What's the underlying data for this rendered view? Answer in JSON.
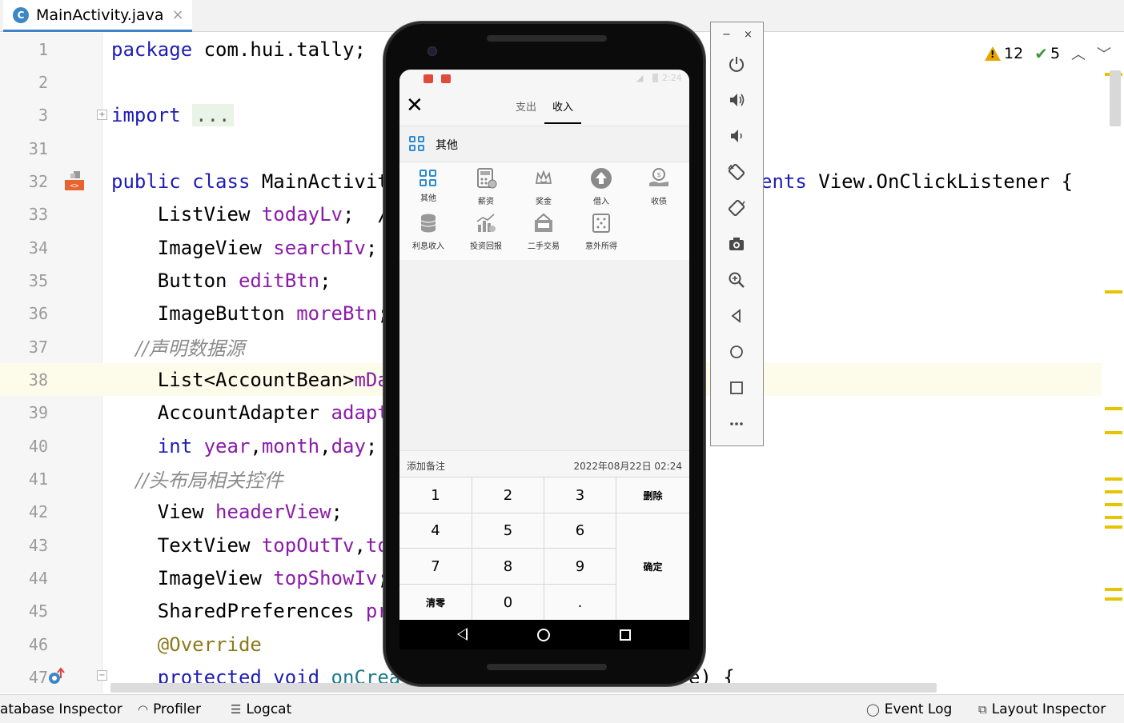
{
  "tab": {
    "icon": "C",
    "title": "MainActivity.java"
  },
  "inspections": {
    "warnings": "12",
    "ok": "5"
  },
  "editor": {
    "lines": [
      {
        "n": "1",
        "t": "package com.hui.tally;"
      },
      {
        "n": "2",
        "t": ""
      },
      {
        "n": "3",
        "kw": "import",
        "fold": "..."
      },
      {
        "n": "31",
        "t": ""
      },
      {
        "n": "32",
        "kw": "public class",
        "t": " MainActivity",
        "kw2": "ents",
        "t2": " View.OnClickListener {"
      },
      {
        "n": "33",
        "t": "    ListView ",
        "f": "todayLv",
        "t2": ";  /"
      },
      {
        "n": "34",
        "t": "    ImageView ",
        "f": "searchIv",
        "t2": ";"
      },
      {
        "n": "35",
        "t": "    Button ",
        "f": "editBtn",
        "t2": ";"
      },
      {
        "n": "36",
        "t": "    ImageButton ",
        "f": "moreBtn",
        "t2": ";"
      },
      {
        "n": "37",
        "c": "    //声明数据源"
      },
      {
        "n": "38",
        "t": "    List<AccountBean>",
        "f": "mDa"
      },
      {
        "n": "39",
        "t": "    AccountAdapter ",
        "f": "adapt"
      },
      {
        "n": "40",
        "kw": "    int",
        "f": " year",
        "t": ",",
        "f2": "month",
        "t2": ",",
        "f3": "day",
        "t3": ";"
      },
      {
        "n": "41",
        "c": "    //头布局相关控件"
      },
      {
        "n": "42",
        "t": "    View ",
        "f": "headerView",
        "t2": ";"
      },
      {
        "n": "43",
        "t": "    TextView ",
        "f": "topOutTv",
        "t2": ",",
        "f2": "to"
      },
      {
        "n": "44",
        "t": "    ImageView ",
        "f": "topShowIv",
        "t2": ";"
      },
      {
        "n": "45",
        "t": "    SharedPreferences ",
        "f": "pr"
      },
      {
        "n": "46",
        "a": "    @Override"
      },
      {
        "n": "47",
        "kw": "    protected void",
        "m": " onCrea",
        "t": "e) {"
      }
    ]
  },
  "bottom_tools": {
    "database": "atabase Inspector",
    "profiler": "Profiler",
    "logcat": "Logcat",
    "event_log": "Event Log",
    "layout_inspector": "Layout Inspector"
  },
  "phone": {
    "status_time": "2:24",
    "tabs": {
      "expense": "支出",
      "income": "收入"
    },
    "selected_category": "其他",
    "categories": [
      "其他",
      "薪资",
      "奖金",
      "借入",
      "收债",
      "利息收入",
      "投资回报",
      "二手交易",
      "意外所得"
    ],
    "note_placeholder": "添加备注",
    "datetime": "2022年08月22日 02:24",
    "keys": {
      "k1": "1",
      "k2": "2",
      "k3": "3",
      "del": "删除",
      "k4": "4",
      "k5": "5",
      "k6": "6",
      "ok": "确定",
      "k7": "7",
      "k8": "8",
      "k9": "9",
      "clear": "清零",
      "k0": "0",
      "dot": "."
    }
  },
  "emulator": {
    "minimize": "−",
    "close": "×"
  },
  "colors": {
    "keyword": "#1d1db6",
    "field": "#8a1ca8",
    "comment": "#8c8c8c",
    "accent": "#2a8bd6",
    "warning": "#e6a700"
  }
}
